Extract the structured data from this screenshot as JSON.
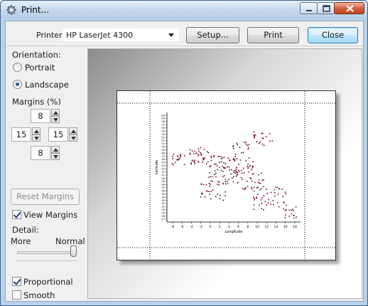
{
  "window": {
    "title": "Print..."
  },
  "toolbar": {
    "printer_label": "Printer:",
    "printer_value": "HP LaserJet 4300",
    "setup_label": "Setup...",
    "print_label": "Print",
    "close_label": "Close"
  },
  "side": {
    "orientation_label": "Orientation:",
    "portrait_label": "Portrait",
    "landscape_label": "Landscape",
    "orientation_selected": "Landscape",
    "margins_label": "Margins (%)",
    "margin_top": "8",
    "margin_left": "15",
    "margin_right": "15",
    "margin_bottom": "8",
    "reset_margins_label": "Reset Margins",
    "view_margins_label": "View Margins",
    "view_margins_checked": true,
    "detail_label": "Detail:",
    "detail_more": "More",
    "detail_normal": "Normal",
    "detail_level": 1.0,
    "proportional_label": "Proportional",
    "proportional_checked": true,
    "smooth_label": "Smooth",
    "smooth_checked": false
  },
  "preview": {
    "y_axis_label": "Latitude",
    "x_axis_label": "Longitude",
    "x_ticks": [
      "-8",
      "-6",
      "-4",
      "-2",
      "0",
      "2",
      "4",
      "6",
      "8",
      "10",
      "12",
      "14",
      "16",
      "18"
    ],
    "y_ticks": [
      "27",
      "28",
      "29",
      "30",
      "31",
      "32",
      "33",
      "34",
      "35",
      "36",
      "37",
      "38",
      "39",
      "40",
      "41",
      "42",
      "43",
      "44",
      "45",
      "46",
      "47",
      "48",
      "49",
      "50",
      "51",
      "52",
      "53",
      "54",
      "55",
      "56",
      "57",
      "58",
      "59",
      "60"
    ]
  },
  "colors": {
    "title_bar": "#c2d7ec",
    "dialog_bg": "#f0f0f0",
    "point": "#6b0f1a"
  }
}
